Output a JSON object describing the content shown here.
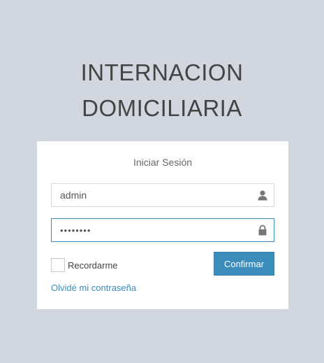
{
  "logo": {
    "line1": "INTERNACION",
    "line2": "DOMICILIARIA"
  },
  "login": {
    "message": "Iniciar Sesión",
    "username": {
      "value": "admin",
      "icon": "user-icon"
    },
    "password": {
      "value": "••••••••",
      "icon": "lock-icon"
    },
    "remember_label": "Recordarme",
    "remember_checked": false,
    "confirm_label": "Confirmar",
    "forgot_label": "Olvidé mi contraseña"
  },
  "colors": {
    "background": "#d2d6de",
    "primary": "#3c8dbc",
    "icon": "#777777"
  }
}
